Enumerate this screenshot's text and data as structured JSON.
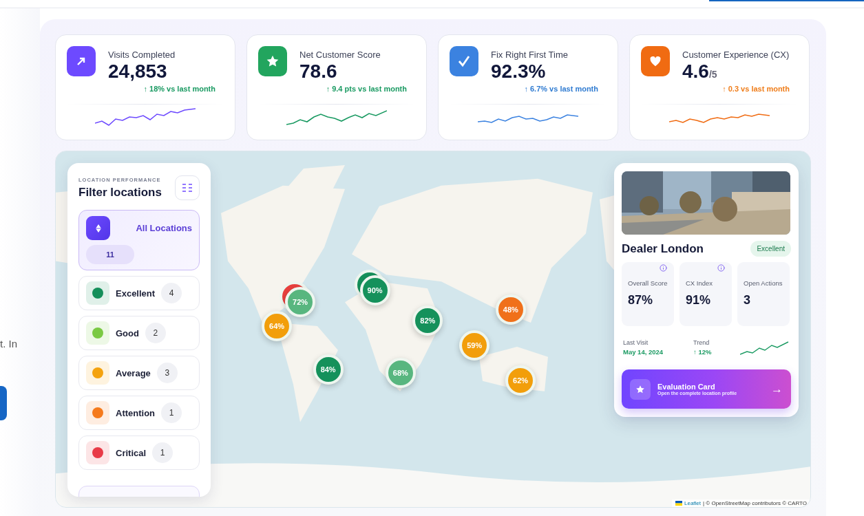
{
  "page_fragment": {
    "text": "t. In"
  },
  "kpis": [
    {
      "kind": "arrow",
      "color": "#6d4aff",
      "title": "Visits Completed",
      "value": "24,853",
      "trend": {
        "text": "↑ 18% vs last month",
        "color": "#1a9a62"
      }
    },
    {
      "kind": "star",
      "color": "#22a55e",
      "title": "Net Customer Score",
      "value": "78.6",
      "trend": {
        "text": "↑ 9.4 pts vs last month",
        "color": "#1a9a62"
      }
    },
    {
      "kind": "check",
      "color": "#3b82e0",
      "title": "Fix Right First Time",
      "value": "92.3%",
      "trend": {
        "text": "↑ 6.7% vs last month",
        "color": "#2f7bd1"
      }
    },
    {
      "kind": "heart",
      "color": "#f06b12",
      "title": "Customer Experience (CX)",
      "value": "4.6",
      "suffix": "/5",
      "trend": {
        "text": "↑ 0.3 vs last month",
        "color": "#ef7d1a"
      }
    }
  ],
  "filter_panel": {
    "eyebrow": "LOCATION PERFORMANCE",
    "title": "Filter locations",
    "items": [
      {
        "kind": "all",
        "label": "All Locations",
        "count": "11",
        "selected": true
      },
      {
        "kind": "status",
        "label": "Excellent",
        "count": "4",
        "color": "#158f5a",
        "selected": false
      },
      {
        "kind": "status",
        "label": "Good",
        "count": "2",
        "color": "#7ac943",
        "selected": false
      },
      {
        "kind": "status",
        "label": "Average",
        "count": "3",
        "color": "#f4a20e",
        "selected": false
      },
      {
        "kind": "status",
        "label": "Attention",
        "count": "1",
        "color": "#f57a1c",
        "selected": false
      },
      {
        "kind": "status",
        "label": "Critical",
        "count": "1",
        "color": "#e83a47",
        "selected": false
      }
    ]
  },
  "markers": [
    {
      "label": "72%",
      "color": "#58b67f",
      "behind": {
        "color": "#e8403e"
      }
    },
    {
      "label": "64%",
      "color": "#f29e0b"
    },
    {
      "label": "90%",
      "color": "#15915b",
      "behind": {
        "color": "#15915b"
      }
    },
    {
      "label": "82%",
      "color": "#15915b"
    },
    {
      "label": "48%",
      "color": "#f0701a"
    },
    {
      "label": "59%",
      "color": "#f29e0b"
    },
    {
      "label": "68%",
      "color": "#58b67f"
    },
    {
      "label": "84%",
      "color": "#15915b"
    },
    {
      "label": "62%",
      "color": "#f29e0b"
    }
  ],
  "location_card": {
    "title": "Dealer London",
    "badge": "Excellent",
    "stats": [
      {
        "label": "Overall Score",
        "value": "87%",
        "info": true
      },
      {
        "label": "CX Index",
        "value": "91%",
        "info": true
      },
      {
        "label": "Open Actions",
        "value": "3",
        "info": false
      }
    ],
    "last_visit": {
      "label": "Last Visit",
      "value": "May 14, 2024"
    },
    "trend": {
      "label": "Trend",
      "value": "↑ 12%"
    },
    "button": {
      "title": "Evaluation Card",
      "subtitle": "Open the complete location profile",
      "arrow": "→"
    }
  },
  "attribution": {
    "link": "Leaflet",
    "text": "| © OpenStreetMap contributors © CARTO"
  }
}
